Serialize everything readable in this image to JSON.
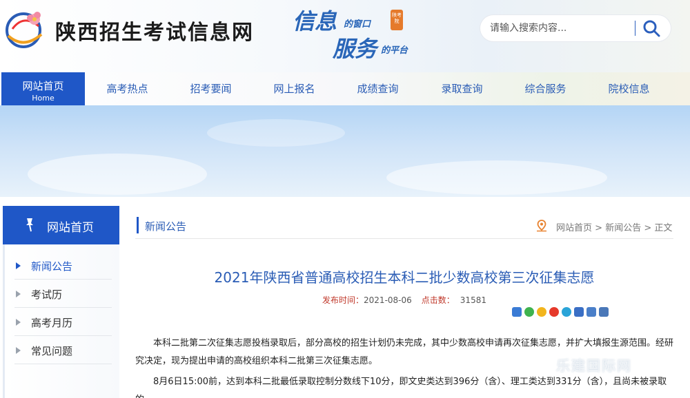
{
  "header": {
    "site_title": "陕西招生考试信息网",
    "slogan": {
      "line1_big": "信息",
      "line1_small": "的窗口",
      "line2_big": "服务",
      "line2_small": "的平台",
      "seal": "陕考院"
    },
    "search": {
      "placeholder": "请输入搜索内容..."
    }
  },
  "nav": {
    "items": [
      {
        "label": "网站首页",
        "sub": "Home"
      },
      {
        "label": "高考热点"
      },
      {
        "label": "招考要闻"
      },
      {
        "label": "网上报名"
      },
      {
        "label": "成绩查询"
      },
      {
        "label": "录取查询"
      },
      {
        "label": "综合服务"
      },
      {
        "label": "院校信息"
      }
    ]
  },
  "sidebar": {
    "title": "网站首页",
    "items": [
      {
        "label": "新闻公告"
      },
      {
        "label": "考试历"
      },
      {
        "label": "高考月历"
      },
      {
        "label": "常见问题"
      }
    ]
  },
  "content": {
    "section_title": "新闻公告",
    "breadcrumb": {
      "home": "网站首页",
      "sep1": " > ",
      "section": "新闻公告",
      "sep2": " > ",
      "current": "正文"
    },
    "article": {
      "title": "2021年陕西省普通高校招生本科二批少数高校第三次征集志愿",
      "published_label": "发布时间：",
      "published": "2021-08-06",
      "views_label": "点击数：",
      "views": "31581",
      "paragraphs": [
        "本科二批第二次征集志愿投档录取后，部分高校的招生计划仍未完成，其中少数高校申请再次征集志愿，并扩大填报生源范围。经研究决定，现为提出申请的高校组织本科二批第三次征集志愿。",
        "8月6日15:00前，达到本科二批最低录取控制分数线下10分，即文史类达到396分（含）、理工类达到331分（含），且尚未被录取的"
      ]
    },
    "share_icons": [
      "share-plus-icon",
      "wechat-icon",
      "qzone-icon",
      "weibo-icon",
      "pinterest-icon",
      "tencent-icon",
      "email-icon",
      "print-icon"
    ]
  },
  "watermark": "乐建国际网",
  "colors": {
    "brand_blue": "#1f57c7",
    "link_blue": "#2a5cb5",
    "meta_red": "#c0392b"
  }
}
